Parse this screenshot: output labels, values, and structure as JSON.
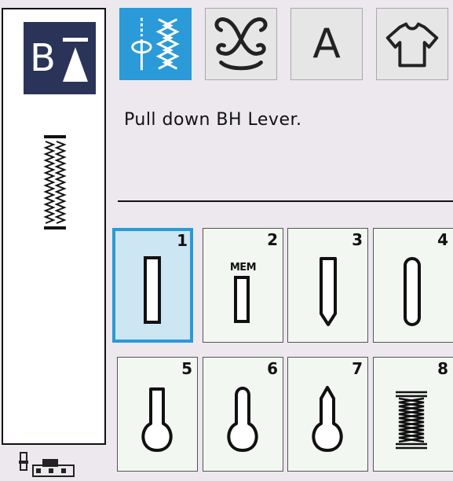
{
  "foot_button": {
    "label": "B",
    "icon": "buttonhole-foot-up-arrow-icon"
  },
  "preview": {
    "icon": "buttonhole-preview-icon"
  },
  "presser_foot": {
    "icon": "presser-foot-icon"
  },
  "tabs": [
    {
      "icon": "utility-stitch-icon",
      "active": true
    },
    {
      "icon": "decorative-stitch-icon",
      "active": false
    },
    {
      "label": "A",
      "icon": "letter-A-icon",
      "active": false
    },
    {
      "icon": "shirt-icon",
      "active": false
    }
  ],
  "message": "Pull down BH Lever.",
  "stitches": [
    {
      "number": "1",
      "shape": "square-buttonhole",
      "selected": true
    },
    {
      "number": "2",
      "mem": "MEM",
      "shape": "small-square-buttonhole",
      "selected": false
    },
    {
      "number": "3",
      "shape": "tapered-buttonhole",
      "selected": false
    },
    {
      "number": "4",
      "shape": "rounded-buttonhole",
      "selected": false
    },
    {
      "number": "5",
      "shape": "keyhole-square-buttonhole",
      "selected": false
    },
    {
      "number": "6",
      "shape": "keyhole-rounded-buttonhole",
      "selected": false
    },
    {
      "number": "7",
      "shape": "keyhole-tapered-buttonhole",
      "selected": false
    },
    {
      "number": "8",
      "shape": "zigzag-bartack-buttonhole",
      "selected": false
    }
  ],
  "colors": {
    "accent": "#2a9ad8",
    "selected_fill": "#cce6f3",
    "foot_button_bg": "#2a3358",
    "background": "#ece8ee"
  }
}
